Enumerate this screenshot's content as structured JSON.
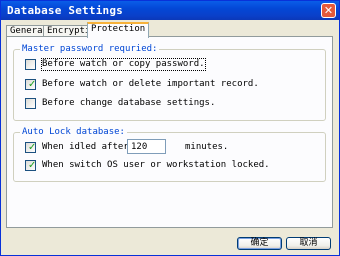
{
  "window": {
    "title": "Database Settings",
    "close_glyph": "✕"
  },
  "tabs": [
    {
      "label": "General"
    },
    {
      "label": "Encryption"
    },
    {
      "label": "Protection",
      "active": true
    }
  ],
  "master_password": {
    "legend": "Master password requried:",
    "options": [
      {
        "label": "Before watch or copy password.",
        "checked": false
      },
      {
        "label": "Before watch or delete important record.",
        "checked": true
      },
      {
        "label": "Before change database settings.",
        "checked": false
      }
    ]
  },
  "auto_lock": {
    "legend": "Auto Lock database:",
    "idle": {
      "label": "When idled after",
      "checked": true,
      "value": "120",
      "unit": "minutes."
    },
    "switch_user": {
      "label": "When switch OS user or workstation locked.",
      "checked": true
    }
  },
  "buttons": {
    "ok": "确定",
    "cancel": "取消"
  },
  "check_glyph": "✓",
  "colors": {
    "title_bar": "#0a5de8",
    "group_legend": "#0046d5",
    "checkmark": "#21a121",
    "close_button": "#e45a3b",
    "active_tab_accent": "#f7b23a"
  }
}
